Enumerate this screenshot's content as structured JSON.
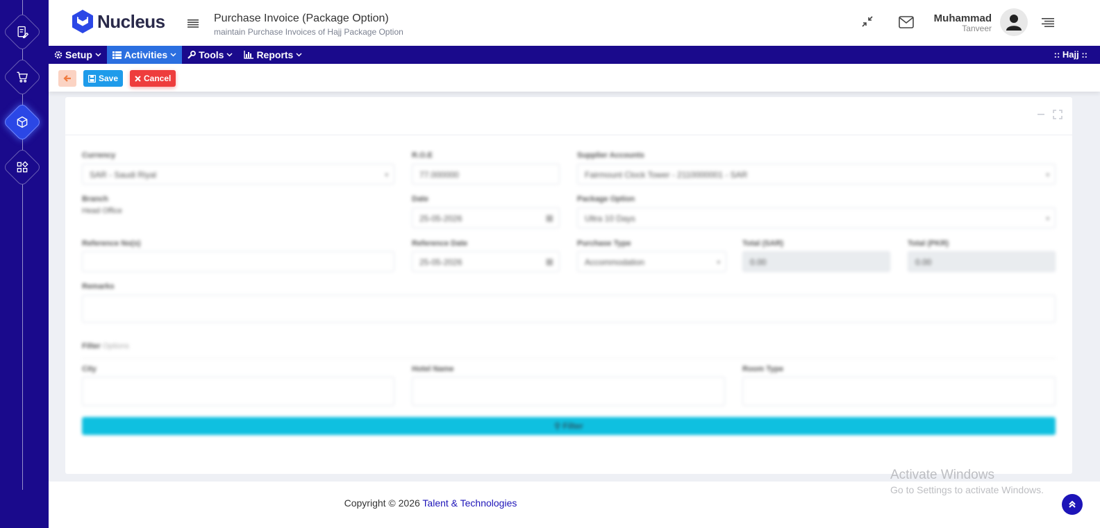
{
  "app": {
    "logo_text": "Nucleus"
  },
  "header": {
    "title": "Purchase Invoice (Package Option)",
    "subtitle": "maintain Purchase Invoices of Hajj Package Option",
    "user_name": "Muhammad",
    "user_sub": "Tanveer"
  },
  "rail": {
    "items": [
      "document-edit-icon",
      "cart-icon",
      "cube-icon",
      "apps-grid-icon"
    ],
    "active": "cube-icon"
  },
  "nav": {
    "items": [
      {
        "label": "Setup",
        "icon": "gear-icon"
      },
      {
        "label": "Activities",
        "icon": "table-icon"
      },
      {
        "label": "Tools",
        "icon": "wrench-icon"
      },
      {
        "label": "Reports",
        "icon": "bar-chart-icon"
      }
    ],
    "active": "Activities",
    "right_label": ":: Hajj ::"
  },
  "toolbar": {
    "save_label": "Save",
    "cancel_label": "Cancel"
  },
  "form": {
    "currency_label": "Currency",
    "currency_value": "SAR - Saudi Riyal",
    "roe_label": "R.O.E",
    "roe_value": "77.000000",
    "supplier_label": "Supplier Accounts",
    "supplier_value": "Fairmount Clock Tower - 2110000001 - SAR",
    "branch_label": "Branch",
    "branch_value": "Head Office",
    "date_label": "Date",
    "date_value": "25-05-2026",
    "package_label": "Package Option",
    "package_value": "Ultra 10 Days",
    "reference_no_label": "Reference No(s)",
    "reference_no_value": "",
    "reference_date_label": "Reference Date",
    "reference_date_value": "25-05-2026",
    "purchase_type_label": "Purchase Type",
    "purchase_type_value": "Accommodation",
    "total_sar_label": "Total (SAR)",
    "total_sar_value": "0.00",
    "total_pkr_label": "Total (PKR)",
    "total_pkr_value": "0.00",
    "remarks_label": "Remarks",
    "remarks_value": "",
    "filter_heading": "Filter",
    "filter_heading_sub": "Options",
    "city_label": "City",
    "hotel_label": "Hotel Name",
    "room_label": "Room Type",
    "filter_button": "Filter"
  },
  "footer": {
    "copyright": "Copyright © 2026 ",
    "company": "Talent & Technologies"
  },
  "watermark": {
    "line1": "Activate Windows",
    "line2": "Go to Settings to activate Windows."
  },
  "colors": {
    "rail": "#1a0a8c",
    "accent": "#2b6fe0",
    "save": "#1e9bea",
    "cancel": "#ee3d3d",
    "filter": "#0fc0e0"
  }
}
